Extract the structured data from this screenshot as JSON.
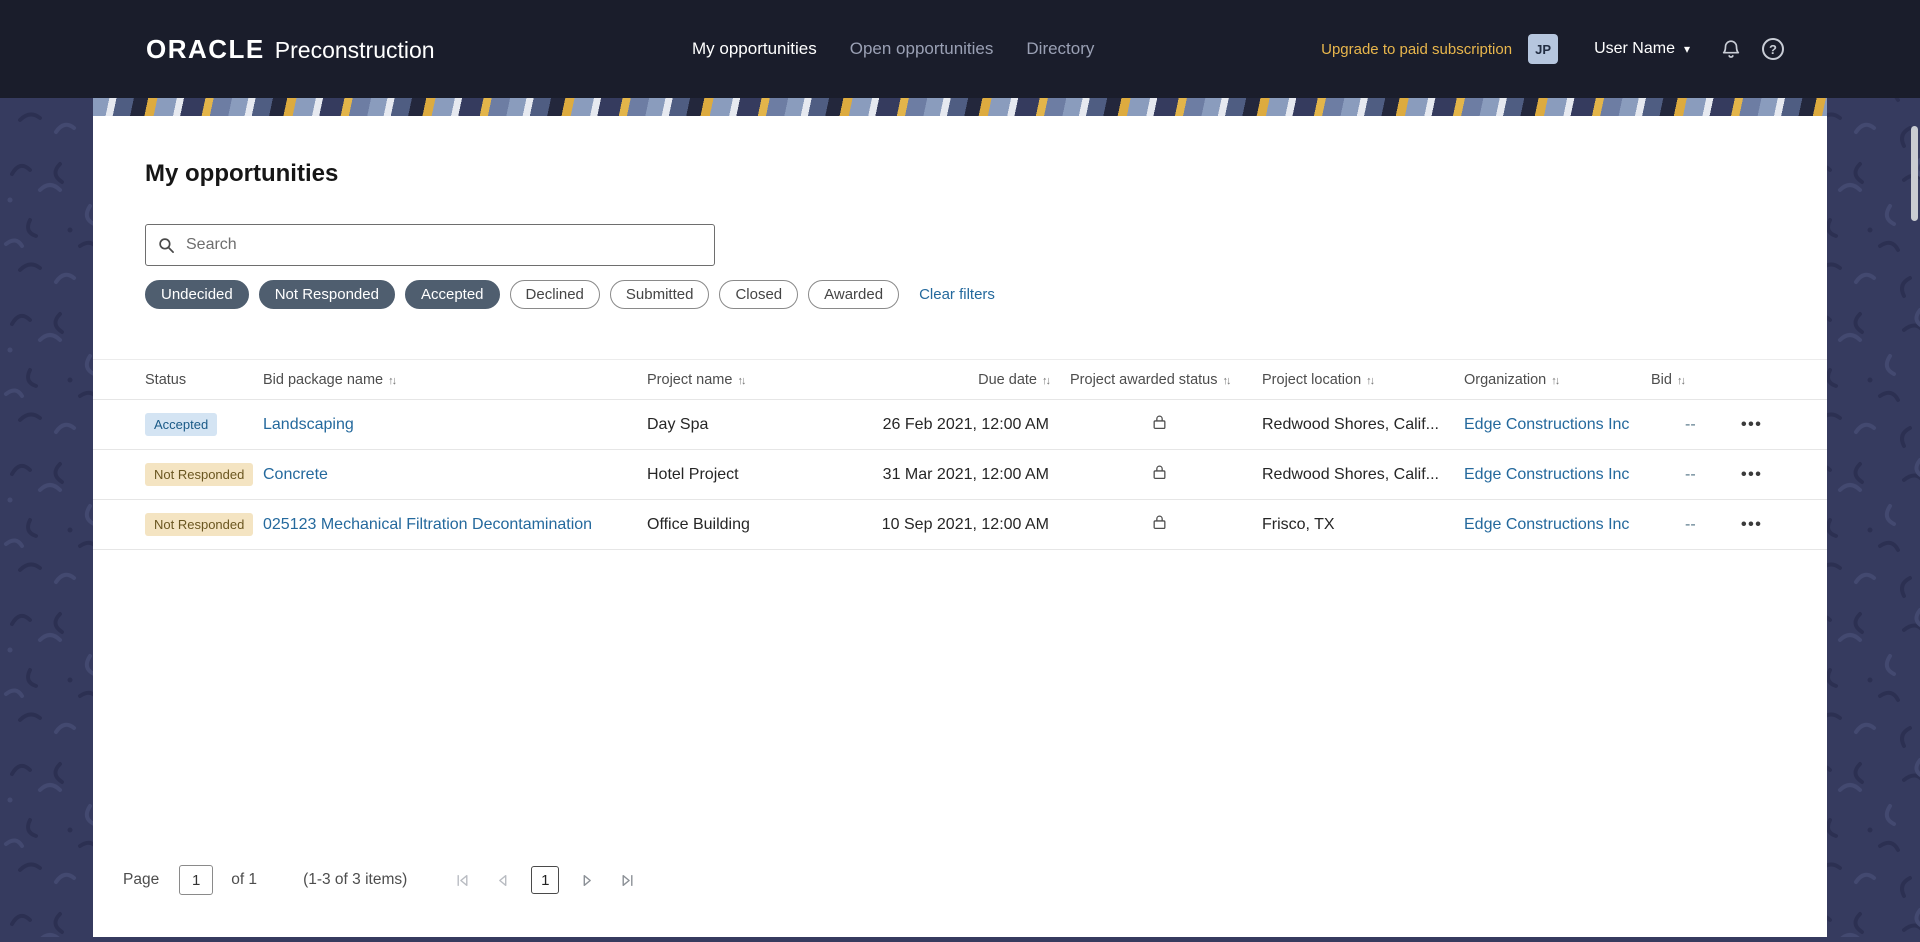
{
  "header": {
    "brand": {
      "name": "ORACLE",
      "product": "Preconstruction"
    },
    "nav": [
      {
        "label": "My opportunities",
        "active": true
      },
      {
        "label": "Open opportunities",
        "active": false
      },
      {
        "label": "Directory",
        "active": false
      }
    ],
    "upgrade_label": "Upgrade to paid subscription",
    "avatar_initials": "JP",
    "user_name": "User Name"
  },
  "main": {
    "title": "My opportunities",
    "search_placeholder": "Search",
    "filters": [
      {
        "label": "Undecided",
        "selected": true
      },
      {
        "label": "Not Responded",
        "selected": true
      },
      {
        "label": "Accepted",
        "selected": true
      },
      {
        "label": "Declined",
        "selected": false
      },
      {
        "label": "Submitted",
        "selected": false
      },
      {
        "label": "Closed",
        "selected": false
      },
      {
        "label": "Awarded",
        "selected": false
      }
    ],
    "clear_filters_label": "Clear filters"
  },
  "table": {
    "columns": [
      {
        "label": "Status",
        "sortable": false
      },
      {
        "label": "Bid package name",
        "sortable": true
      },
      {
        "label": "Project name",
        "sortable": true
      },
      {
        "label": "Due date",
        "sortable": true
      },
      {
        "label": "Project awarded status",
        "sortable": true
      },
      {
        "label": "Project location",
        "sortable": true
      },
      {
        "label": "Organization",
        "sortable": true
      },
      {
        "label": "Bid",
        "sortable": true
      }
    ],
    "rows": [
      {
        "status": "Accepted",
        "status_kind": "accepted",
        "bid_package_name": "Landscaping",
        "project_name": "Day Spa",
        "due_date": "26 Feb 2021, 12:00 AM",
        "awarded_status_icon": "lock-icon",
        "project_location": "Redwood Shores, Calif...",
        "organization": "Edge Constructions Inc",
        "bid": "--"
      },
      {
        "status": "Not Responded",
        "status_kind": "not-responded",
        "bid_package_name": "Concrete",
        "project_name": "Hotel Project",
        "due_date": "31 Mar 2021, 12:00 AM",
        "awarded_status_icon": "lock-icon",
        "project_location": "Redwood Shores, Calif...",
        "organization": "Edge Constructions Inc",
        "bid": "--"
      },
      {
        "status": "Not Responded",
        "status_kind": "not-responded",
        "bid_package_name": "025123 Mechanical Filtration Decontamination",
        "project_name": "Office Building",
        "due_date": "10 Sep 2021, 12:00 AM",
        "awarded_status_icon": "lock-icon",
        "project_location": "Frisco, TX",
        "organization": "Edge Constructions Inc",
        "bid": "--"
      }
    ]
  },
  "pagination": {
    "page_label": "Page",
    "page_input_value": "1",
    "of_label": "of 1",
    "items_label": "(1-3 of 3 items)",
    "current_page": "1"
  },
  "icons": {
    "sort": "↑↓",
    "user_caret": "▾",
    "row_actions": "•••",
    "help": "?"
  },
  "colors": {
    "header_bg": "#1a1d2b",
    "page_bg": "#363b5f",
    "card_bg": "#ffffff",
    "accent_gold": "#e8b64c",
    "link_blue": "#24699d",
    "chip_selected": "#4f5e6f",
    "badge_accepted_bg": "#d4e4f3",
    "badge_accepted_text": "#1a5a87",
    "badge_not_responded_bg": "#f4e4c2",
    "badge_not_responded_text": "#6a5620"
  }
}
